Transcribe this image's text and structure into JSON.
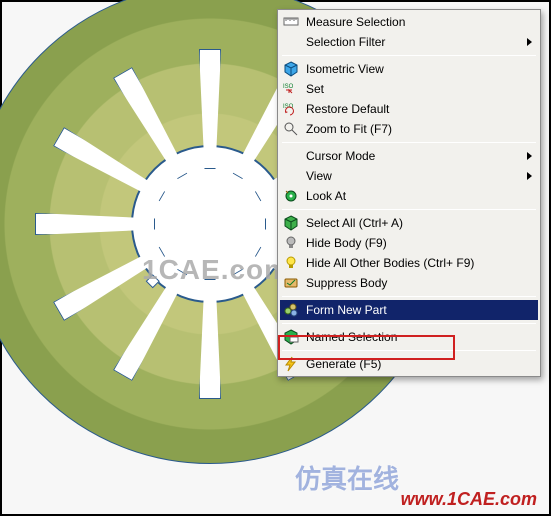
{
  "menu": {
    "measure": "Measure Selection",
    "filter": "Selection Filter",
    "iso": "Isometric View",
    "set": "Set",
    "restore": "Restore Default",
    "zoomfit": "Zoom to Fit (F7)",
    "cursor": "Cursor Mode",
    "view": "View",
    "lookat": "Look At",
    "selectall": "Select All (Ctrl+ A)",
    "hidebody": "Hide Body (F9)",
    "hideother": "Hide All Other Bodies (Ctrl+ F9)",
    "suppress": "Suppress Body",
    "formnew": "Form New Part",
    "named": "Named Selection",
    "generate": "Generate (F5)"
  },
  "watermark": {
    "center": "1CAE.com",
    "cn": "仿真在线",
    "url": "www.1CAE.com"
  }
}
